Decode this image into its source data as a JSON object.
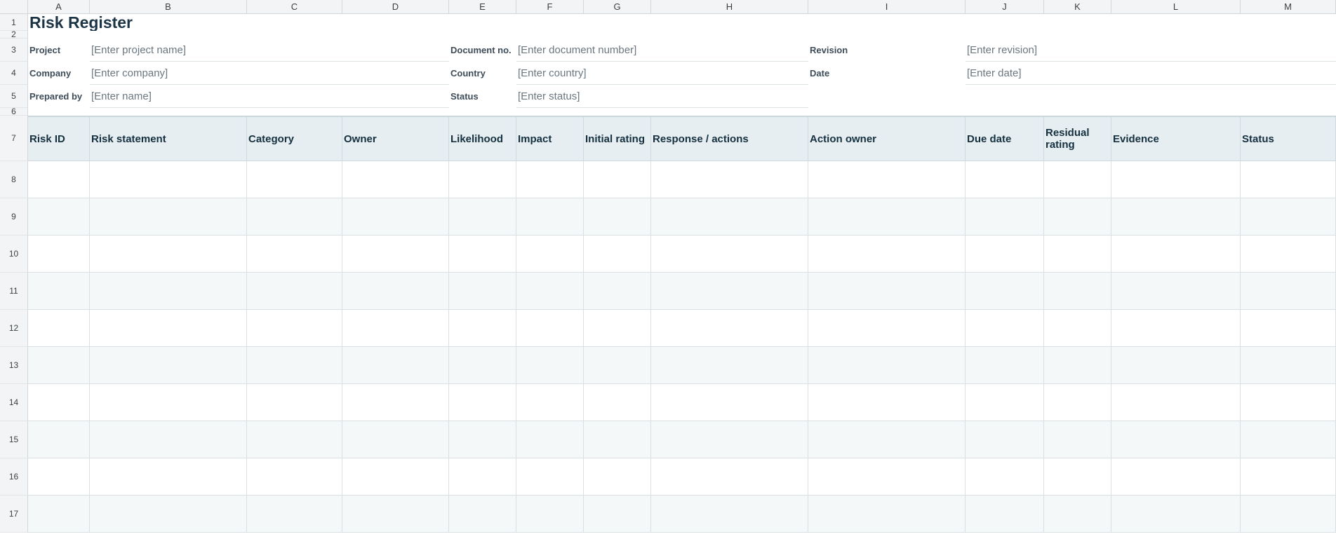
{
  "column_letters": [
    "A",
    "B",
    "C",
    "D",
    "E",
    "F",
    "G",
    "H",
    "I",
    "J",
    "K",
    "L",
    "M"
  ],
  "row_numbers": [
    "1",
    "2",
    "3",
    "4",
    "5",
    "6",
    "7",
    "8",
    "9",
    "10",
    "11",
    "12",
    "13",
    "14",
    "15",
    "16",
    "17"
  ],
  "title": "Risk Register",
  "meta": {
    "project_label": "Project",
    "project_value": "[Enter project name]",
    "document_label": "Document no.",
    "document_value": "[Enter document number]",
    "revision_label": "Revision",
    "revision_value": "[Enter revision]",
    "company_label": "Company",
    "company_value": "[Enter company]",
    "country_label": "Country",
    "country_value": "[Enter country]",
    "date_label": "Date",
    "date_value": "[Enter date]",
    "prepared_label": "Prepared by",
    "prepared_value": "[Enter name]",
    "status_label": "Status",
    "status_value": "[Enter status]"
  },
  "table_headers": [
    "Risk ID",
    "Risk statement",
    "Category",
    "Owner",
    "Likelihood",
    "Impact",
    "Initial rating",
    "Response / actions",
    "Action owner",
    "Due date",
    "Residual rating",
    "Evidence",
    "Status"
  ],
  "data_row_count": 10,
  "colors": {
    "header_fill": "#e6eef2",
    "alt_row_fill": "#f4f8f9",
    "title_text": "#1b3446"
  }
}
